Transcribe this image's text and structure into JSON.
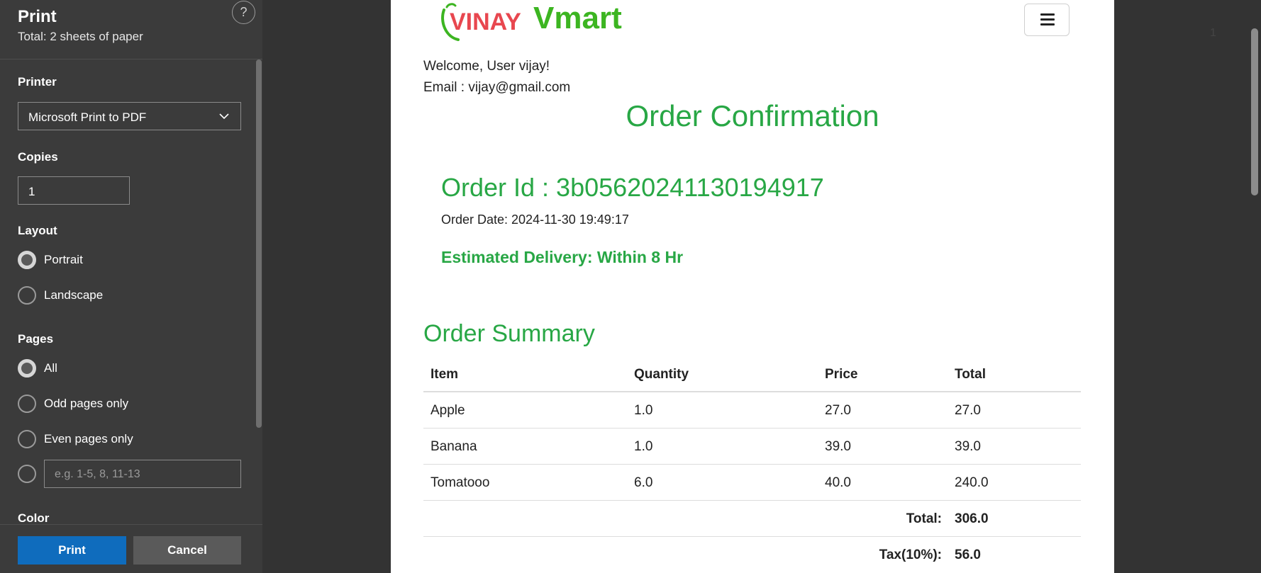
{
  "panel": {
    "title": "Print",
    "subtitle": "Total: 2 sheets of paper",
    "help_label": "?",
    "printer_label": "Printer",
    "printer_value": "Microsoft Print to PDF",
    "copies_label": "Copies",
    "copies_value": "1",
    "layout_label": "Layout",
    "layout_options": [
      {
        "label": "Portrait",
        "checked": true
      },
      {
        "label": "Landscape",
        "checked": false
      }
    ],
    "pages_label": "Pages",
    "pages_options": [
      {
        "label": "All",
        "checked": true
      },
      {
        "label": "Odd pages only",
        "checked": false
      },
      {
        "label": "Even pages only",
        "checked": false
      }
    ],
    "custom_range_placeholder": "e.g. 1-5, 8, 11-13",
    "color_label": "Color",
    "print_button": "Print",
    "cancel_button": "Cancel"
  },
  "preview": {
    "page_number": "1",
    "logo": {
      "text_left": "VINAY",
      "text_right": "Vmart",
      "colors": {
        "red": "#e8474f",
        "green": "#3cb521"
      }
    },
    "welcome": "Welcome, User vijay!",
    "email": "Email : vijay@gmail.com",
    "title": "Order Confirmation",
    "order_id": "Order Id : 3b05620241130194917",
    "order_date": "Order Date: 2024-11-30 19:49:17",
    "estimated_delivery": "Estimated Delivery: Within 8 Hr",
    "summary_title": "Order Summary",
    "table": {
      "headers": [
        "Item",
        "Quantity",
        "Price",
        "Total"
      ],
      "rows": [
        [
          "Apple",
          "1.0",
          "27.0",
          "27.0"
        ],
        [
          "Banana",
          "1.0",
          "39.0",
          "39.0"
        ],
        [
          "Tomatooo",
          "6.0",
          "40.0",
          "240.0"
        ]
      ],
      "total_label": "Total:",
      "total_value": "306.0",
      "tax_label": "Tax(10%):",
      "tax_value": "56.0"
    },
    "accent_color": "#28a745"
  }
}
